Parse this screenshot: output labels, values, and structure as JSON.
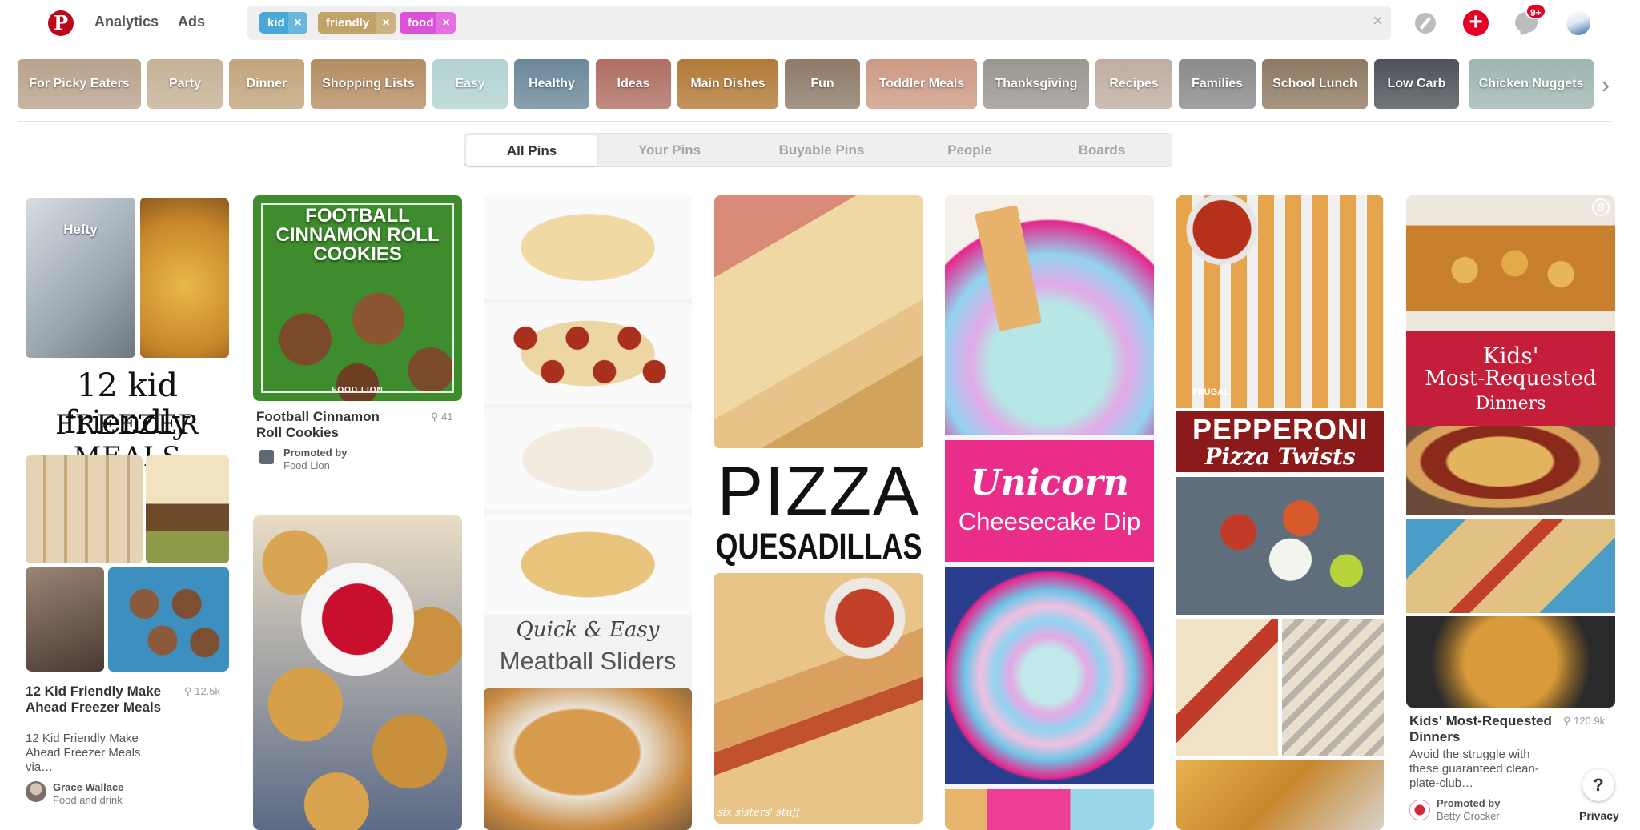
{
  "header": {
    "logo_letter": "P",
    "nav": {
      "analytics": "Analytics",
      "ads": "Ads"
    },
    "search": {
      "chips": [
        {
          "label": "kid",
          "color": "#49a8d6"
        },
        {
          "label": "friendly",
          "color": "#c1a268"
        },
        {
          "label": "food",
          "color": "#dd50d9"
        }
      ],
      "chip_remove": "×",
      "placeholder": "",
      "clear": "×"
    },
    "icons": [
      "compass-icon",
      "plus-icon",
      "chat-icon",
      "avatar"
    ],
    "notification_count": "9+"
  },
  "guides": [
    {
      "label": "For Picky Eaters",
      "color": "#b8a28c"
    },
    {
      "label": "Party",
      "color": "#c6b196"
    },
    {
      "label": "Dinner",
      "color": "#c2a57c"
    },
    {
      "label": "Shopping Lists",
      "color": "#b48d62"
    },
    {
      "label": "Easy",
      "color": "#b3d2d2"
    },
    {
      "label": "Healthy",
      "color": "#6b8899"
    },
    {
      "label": "Ideas",
      "color": "#b06e62"
    },
    {
      "label": "Main Dishes",
      "color": "#b27a38"
    },
    {
      "label": "Fun",
      "color": "#8e7a68"
    },
    {
      "label": "Toddler Meals",
      "color": "#cc9a84"
    },
    {
      "label": "Thanksgiving",
      "color": "#9b9690"
    },
    {
      "label": "Recipes",
      "color": "#c0ada2"
    },
    {
      "label": "Families",
      "color": "#8a8a8a"
    },
    {
      "label": "School Lunch",
      "color": "#8e7a62"
    },
    {
      "label": "Low Carb",
      "color": "#4e535a"
    },
    {
      "label": "Chicken Nuggets",
      "color": "#9fb6b2"
    }
  ],
  "tabs": [
    "All Pins",
    "Your Pins",
    "Buyable Pins",
    "People",
    "Boards"
  ],
  "pins": {
    "freezer": {
      "overlay_line1": "12 kid friendly",
      "overlay_line2": "FREEZER MEALS",
      "bag_label": "Hefty",
      "title": "12 Kid Friendly Make Ahead Freezer Meals",
      "saves": "12.5k",
      "description": "12 Kid Friendly Make Ahead Freezer Meals via…",
      "pinner_name": "Grace Wallace",
      "pinner_board": "Food and drink"
    },
    "cookies": {
      "overlay": "FOOTBALL CINNAMON ROLL COOKIES",
      "brand_mark": "FOOD LION",
      "title": "Football Cinnamon Roll Cookies",
      "saves": "41",
      "promoted_label": "Promoted by",
      "promoter": "Food Lion"
    },
    "sliders": {
      "overlay_line1": "Quick & Easy",
      "overlay_line2": "Meatball Sliders"
    },
    "quesadillas": {
      "overlay_line1": "PIZZA",
      "overlay_line2": "QUESADILLAS",
      "watermark": "six sisters' stuff"
    },
    "unicorn": {
      "overlay_line1": "Unicorn",
      "overlay_line2": "Cheesecake Dip"
    },
    "twists": {
      "overlay_line1": "PEPPERONI",
      "overlay_line2": "Pizza Twists",
      "watermark": "FRUGAL"
    },
    "kids_dinners": {
      "overlay_line1": "Kids'",
      "overlay_line2": "Most-Requested",
      "overlay_line3": "Dinners",
      "corner_mark": "B",
      "title": "Kids' Most-Requested Dinners",
      "saves": "120.9k",
      "description": "Avoid the struggle with these guaranteed clean-plate-club…",
      "promoted_label": "Promoted by",
      "promoter": "Betty Crocker"
    }
  },
  "help": {
    "label": "?",
    "privacy": "Privacy"
  }
}
